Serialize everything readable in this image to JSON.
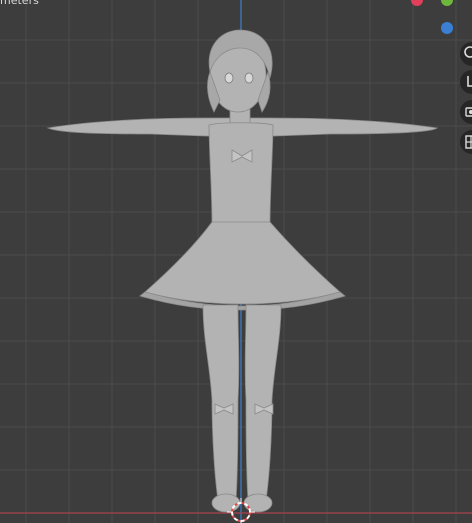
{
  "viewport": {
    "units_label": "meters",
    "background_color": "#3d3d3d",
    "grid_color": "#4a4a4a",
    "x_axis_color": "#a8424f",
    "z_axis_color": "#3f7fcf",
    "model_color": "#b5b5b5",
    "model_shadow_color": "#8c8c8c"
  },
  "gizmo": {
    "x_color": "#e0405a",
    "y_color": "#6db83a",
    "z_color": "#3b7fd4"
  },
  "nav_icons": [
    "zoom-icon",
    "pan-icon",
    "camera-icon",
    "perspective-grid-icon"
  ]
}
